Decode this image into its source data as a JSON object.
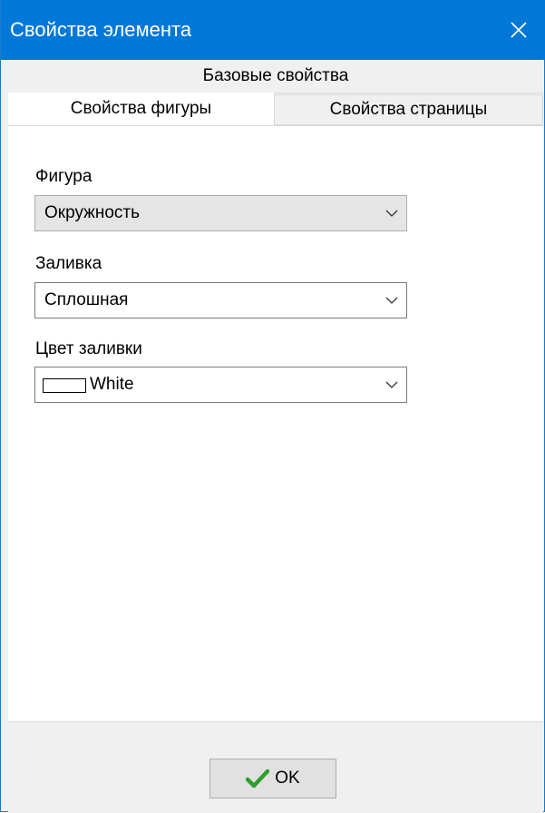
{
  "window": {
    "title": "Свойства элемента",
    "close_icon": "close-icon"
  },
  "tabs": {
    "base": "Базовые свойства",
    "figure": "Свойства фигуры",
    "page": "Свойства страницы",
    "active": "figure"
  },
  "fields": {
    "figure": {
      "label": "Фигура",
      "value": "Окружность",
      "readonly": true
    },
    "fill": {
      "label": "Заливка",
      "value": "Сплошная"
    },
    "fill_color": {
      "label": "Цвет заливки",
      "value": "White",
      "swatch_color": "#ffffff"
    }
  },
  "footer": {
    "ok_label": "OK",
    "ok_icon": "checkmark-icon",
    "ok_icon_color": "#2e9e2e"
  },
  "colors": {
    "titlebar": "#0078d7",
    "window_bg": "#f0f0f0",
    "panel_bg": "#ffffff"
  }
}
